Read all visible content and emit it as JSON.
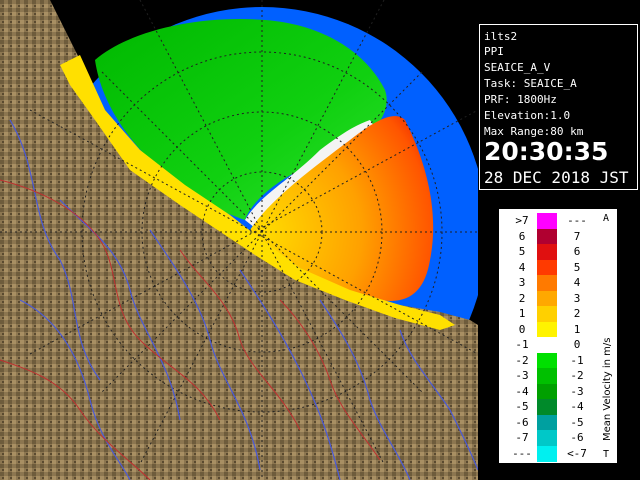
{
  "info": {
    "site": "ilts2",
    "product": "PPI",
    "task_id": "SEAICE_A_V",
    "task": "Task: SEAICE_A",
    "prf": "PRF: 1800Hz",
    "elevation": "Elevation:1.0",
    "max_range": "Max Range:80 km",
    "time": "20:30:35",
    "date": "28 DEC 2018 JST"
  },
  "legend": {
    "title": "Mean Velocity in m/s",
    "corner_top": "A",
    "corner_bottom": "T",
    "rows": [
      {
        "left": ">7",
        "right": "---",
        "color": "#ff00ff"
      },
      {
        "left": "6",
        "right": "7",
        "color": "#b00030"
      },
      {
        "left": "5",
        "right": "6",
        "color": "#e01010"
      },
      {
        "left": "4",
        "right": "5",
        "color": "#ff3a00"
      },
      {
        "left": "3",
        "right": "4",
        "color": "#ff7a00"
      },
      {
        "left": "2",
        "right": "3",
        "color": "#ffa800"
      },
      {
        "left": "1",
        "right": "2",
        "color": "#ffd000"
      },
      {
        "left": "0",
        "right": "1",
        "color": "#fff300"
      },
      {
        "left": "-1",
        "right": "0",
        "color": "#ffffff"
      },
      {
        "left": "-2",
        "right": "-1",
        "color": "#00e000"
      },
      {
        "left": "-3",
        "right": "-2",
        "color": "#00c000"
      },
      {
        "left": "-4",
        "right": "-3",
        "color": "#00a000"
      },
      {
        "left": "-5",
        "right": "-4",
        "color": "#008a2a"
      },
      {
        "left": "-6",
        "right": "-5",
        "color": "#00a0a0"
      },
      {
        "left": "-7",
        "right": "-6",
        "color": "#00c8c8"
      },
      {
        "left": "---",
        "right": "<-7",
        "color": "#00f0f0"
      }
    ]
  },
  "colors": {
    "range_ring_outer": "#0060ff",
    "range_ring_inner": "#0a58e8",
    "land": "#8a7550",
    "rivers": "#4a5ad8",
    "borders": "#c03030",
    "coast_echo": "#ffe000"
  }
}
